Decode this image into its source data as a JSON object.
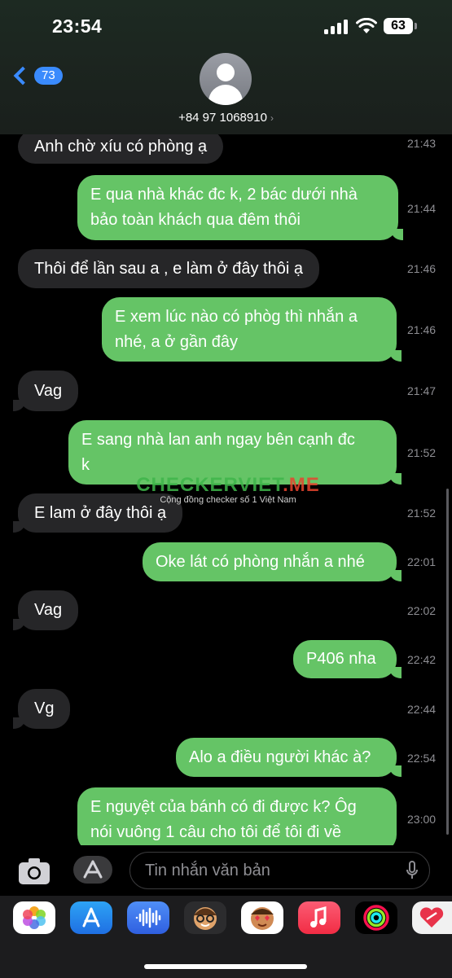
{
  "status_bar": {
    "time": "23:54",
    "battery": "63"
  },
  "header": {
    "back_badge": "73",
    "contact": "+84 97 1068910"
  },
  "messages": [
    {
      "dir": "in",
      "lines": [
        "Anh chờ xíu có phòng ạ"
      ],
      "time": "21:43"
    },
    {
      "dir": "out",
      "lines": [
        "E qua nhà khác đc k, 2 bác dưới nhà",
        "bảo toàn khách qua đêm thôi"
      ],
      "time": "21:44"
    },
    {
      "dir": "in",
      "lines": [
        "Thôi để lần sau a , e làm ở đây thôi ạ"
      ],
      "time": "21:46"
    },
    {
      "dir": "out",
      "lines": [
        "E xem lúc nào có phòg thì nhắn a",
        "nhé, a ở gần đây"
      ],
      "time": "21:46"
    },
    {
      "dir": "in",
      "lines": [
        "Vag"
      ],
      "time": "21:47"
    },
    {
      "dir": "out",
      "lines": [
        "E sang nhà lan anh ngay bên cạnh đc",
        "k"
      ],
      "time": "21:52"
    },
    {
      "dir": "in",
      "lines": [
        "E lam ở đây thôi ạ"
      ],
      "time": "21:52"
    },
    {
      "dir": "out",
      "lines": [
        "Oke lát có phòng nhắn a nhé"
      ],
      "time": "22:01"
    },
    {
      "dir": "in",
      "lines": [
        "Vag"
      ],
      "time": "22:02"
    },
    {
      "dir": "out",
      "lines": [
        "P406 nha"
      ],
      "time": "22:42"
    },
    {
      "dir": "in",
      "lines": [
        "Vg"
      ],
      "time": "22:44"
    },
    {
      "dir": "out",
      "lines": [
        "Alo a điều người khác à?"
      ],
      "time": "22:54"
    },
    {
      "dir": "out",
      "lines": [
        "E nguyệt của bánh có đi được k? Ôg",
        "nói vuông 1 câu cho tôi để tôi đi về"
      ],
      "time": "23:00"
    }
  ],
  "watermark": {
    "title_green": "CHECKERVIET",
    "title_red": ".ME",
    "subtitle": "Cộng đồng checker số 1 Việt Nam"
  },
  "composer": {
    "placeholder": "Tin nhắn văn bản"
  },
  "app_tray": [
    "photos-app-icon",
    "app-store-icon",
    "audio-message-icon",
    "memoji-icon",
    "memoji-stickers-icon",
    "music-app-icon",
    "activity-app-icon",
    "heart-app-icon"
  ],
  "colors": {
    "outgoing": "#65c466",
    "incoming": "#262628",
    "accent": "#3a8bfd"
  }
}
